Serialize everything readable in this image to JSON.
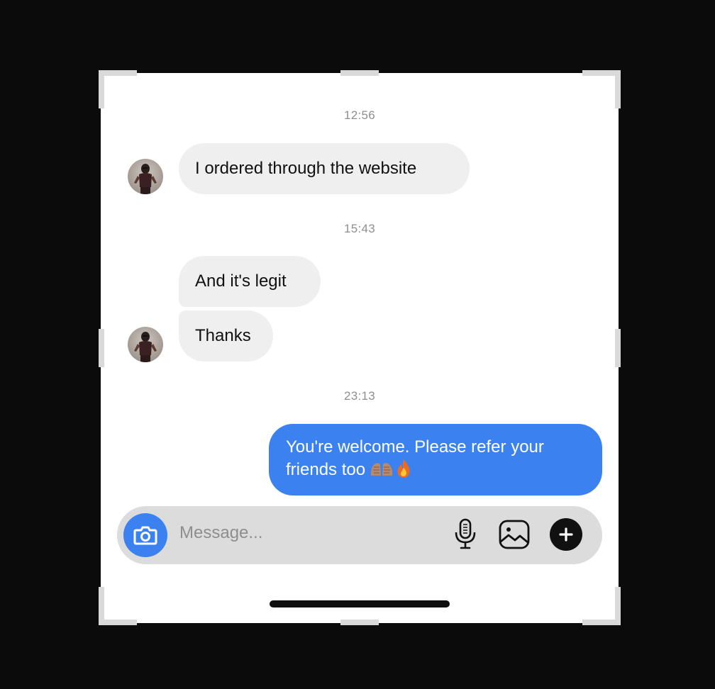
{
  "conversation": {
    "timestamps": [
      "12:56",
      "15:43",
      "23:13"
    ],
    "incoming": [
      {
        "text": "I ordered through the website"
      },
      {
        "text": "And it's legit"
      },
      {
        "text": "Thanks"
      }
    ],
    "outgoing": [
      {
        "text_line1": "You're welcome. Please refer your",
        "text_line2": "friends too"
      }
    ],
    "outgoing_emoji": [
      "folded-hands-emoji",
      "fire-emoji"
    ]
  },
  "composer": {
    "placeholder": "Message...",
    "icons": [
      "camera-icon",
      "microphone-icon",
      "gallery-icon",
      "plus-icon"
    ]
  },
  "colors": {
    "background": "#0b0b0b",
    "canvas": "#ffffff",
    "incoming_bubble": "#efefef",
    "outgoing_bubble": "#3b82f0",
    "composer": "#dcdcdc",
    "timestamp": "#8e8e8e"
  }
}
